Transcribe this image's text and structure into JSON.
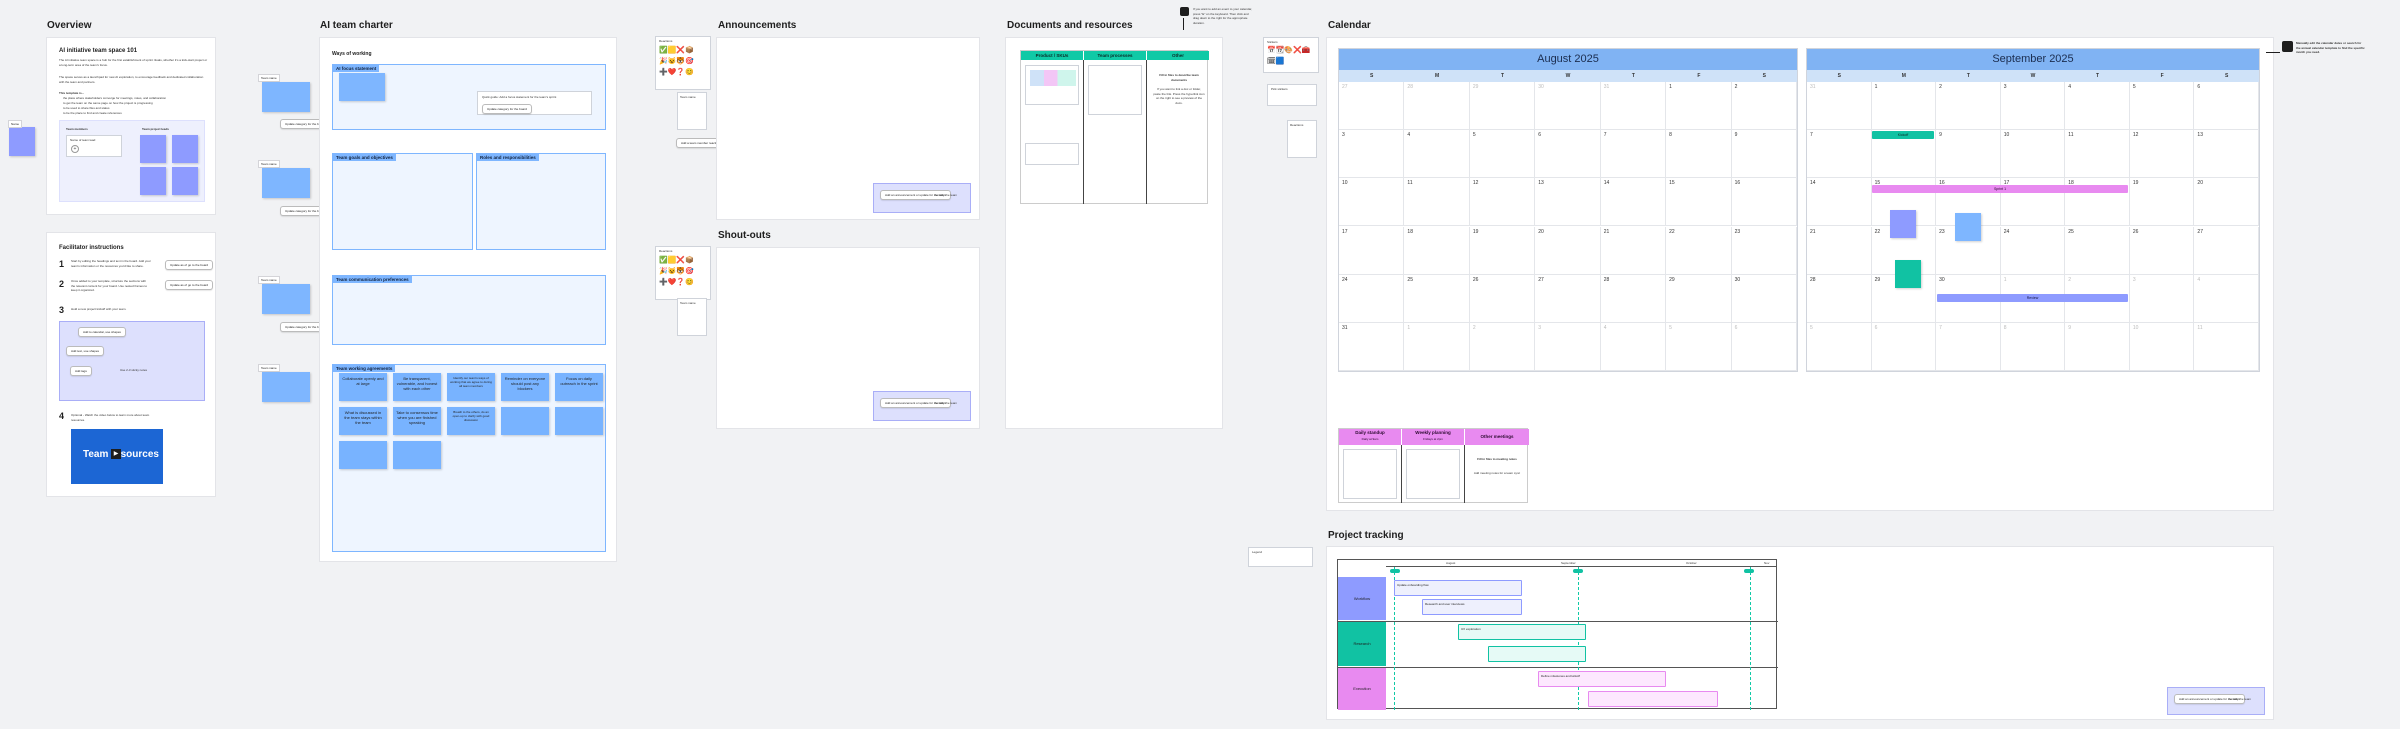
{
  "sections": {
    "overview": "Overview",
    "charter": "AI team charter",
    "announcements": "Announcements",
    "shoutouts": "Shout-outs",
    "documents": "Documents and resources",
    "calendar": "Calendar",
    "project_tracking": "Project tracking"
  },
  "overview": {
    "heading": "AI initiative team space 101",
    "para1": "The AI initiative team space is a hub for the first establishment of sprint rituals, whether it's a kick-start project or a long-term area of the team's focus.",
    "para2": "The space serves as a launchpad for new AI exploration, to encourage feedback and dedicated collaboration with the team and partners.",
    "list_title": "This template is...",
    "list": [
      "the place where stakeholders converge for meetings, notes, and collaboration",
      "to get the team on the same page on how the project is progressing",
      "to be used to share files and status",
      "to be the place to find and create references"
    ],
    "team_members": "Team members",
    "team_leads": "Team project leads",
    "name_placeholder": "Name of team lead"
  },
  "facilitator": {
    "title": "Facilitator instructions",
    "step1": "Start by editing the headings and text in the board. Add your team's information or the resources you'd like to share.",
    "step2": "Once added to your template, structure the sections with the relevant content for your board. Use nested frames to keep it organized.",
    "step3": "Hold a new project kickoff with your team.",
    "step4": "Optional - Watch the video below to learn more about team resources.",
    "btn1": "Update as of go to the board",
    "btn2": "Update as of go to the board",
    "video_title": "Team resources",
    "helper1": "Add to calendar, use shapes",
    "helper2": "Add text, use shapes",
    "helper3": "Add tags",
    "helper4": "Use 2-3 sticky notes"
  },
  "charter": {
    "ways": "Ways of working",
    "ai_focus": "AI focus statement",
    "goals": "Team goals and objectives",
    "roles": "Roles and responsibilities",
    "comm": "Team communication preferences",
    "agreements": "Team working agreements",
    "agreement_notes": [
      "Collaborate openly and at large",
      "Be transparent, vulnerable, and honest with each other",
      "Identify our team's ways of working that we agree to during all team members",
      "Reminder on everyone should post any blockers",
      "Focus on daily outreach in the sprint",
      "What is discussed in the team stays within the team",
      "Take to consensus time when you are finished speaking",
      "Breath to the others, do an open-up to clarify with good discussion",
      "",
      ""
    ],
    "side_btn": "Update category for the board",
    "name_tag": "Team name",
    "helper_box": "Quick guide: Add a focus statement for the team's sprint"
  },
  "emoji_labels": {
    "a": "Reactions",
    "b": "Team name",
    "c": "Reactions",
    "d": "Team name",
    "add_btn": "Add a team member reaction"
  },
  "announcements": {
    "note": "Add an announcement or update for the team",
    "note2": "to notify the team"
  },
  "docs": {
    "col1": "Product / SKUs",
    "col2": "Team processes",
    "col3": "Other",
    "other_text": "Fill in files to describe team documents",
    "tip": "If you want to link a doc or folder, paste the link. Press the hyperlink icon on the right to see a preview of the docs."
  },
  "side_note": "If you want to add an event to your calendar, press \"E\" on the keyboard. Then click and drag down to the right for the appropriate duration.",
  "calendar": {
    "tip": "Manually edit the calendar dates or search for the annual calendar template to find the specific month you need.",
    "dow": [
      "S",
      "M",
      "T",
      "W",
      "T",
      "F",
      "S"
    ],
    "aug": {
      "title": "August 2025",
      "weeks": [
        [
          "27",
          "28",
          "29",
          "30",
          "31",
          "1",
          "2"
        ],
        [
          "3",
          "4",
          "5",
          "6",
          "7",
          "8",
          "9"
        ],
        [
          "10",
          "11",
          "12",
          "13",
          "14",
          "15",
          "16"
        ],
        [
          "17",
          "18",
          "19",
          "20",
          "21",
          "22",
          "23"
        ],
        [
          "24",
          "25",
          "26",
          "27",
          "28",
          "29",
          "30"
        ],
        [
          "31",
          "1",
          "2",
          "3",
          "4",
          "5",
          "6"
        ]
      ]
    },
    "sep": {
      "title": "September 2025",
      "weeks": [
        [
          "31",
          "1",
          "2",
          "3",
          "4",
          "5",
          "6"
        ],
        [
          "7",
          "8",
          "9",
          "10",
          "11",
          "12",
          "13"
        ],
        [
          "14",
          "15",
          "16",
          "17",
          "18",
          "19",
          "20"
        ],
        [
          "21",
          "22",
          "23",
          "24",
          "25",
          "26",
          "27"
        ],
        [
          "28",
          "29",
          "30",
          "1",
          "2",
          "3",
          "4"
        ],
        [
          "5",
          "6",
          "7",
          "8",
          "9",
          "10",
          "11"
        ]
      ]
    },
    "events": {
      "e1": "Kickoff",
      "e2": "Sprint 1",
      "e3": "Review"
    },
    "meetings": {
      "col1": "Daily standup",
      "col1_sub": "Daily at 9am",
      "col2": "Weekly planning",
      "col2_sub": "Fridays at 2pm",
      "col3": "Other meetings",
      "other_text": "Fill in files to meeting notes",
      "other_sub": "Add meeting notes for a team sync"
    },
    "sticker_label": "Stickers",
    "sticker2": "Pick stickers",
    "sticker3": "Reactions"
  },
  "tracking": {
    "month1": "August",
    "month2": "September",
    "month3": "October",
    "month4": "Nov",
    "lane1": "Workflow",
    "lane2": "Research",
    "lane3": "Execution",
    "task_a": "Update onboarding flow",
    "task_b": "Research and user interviews",
    "task_c": "UX exploration",
    "task_d": "Define milestones and kickoff",
    "legend": "Legend"
  },
  "colors": {
    "lavender": "#8e9bff",
    "blue": "#7eb6ff",
    "teal": "#11c2a3",
    "pink": "#e88af0",
    "purple": "#b57cf5"
  }
}
